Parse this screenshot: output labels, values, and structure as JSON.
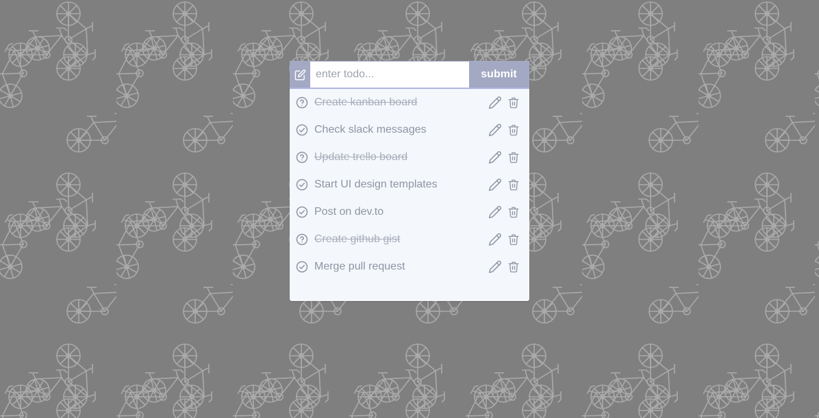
{
  "background": {
    "color": "#7f7f7f",
    "pattern_icon": "bicycle-icon",
    "pattern_color": "#a9a9a9"
  },
  "form": {
    "icon": "edit-square-icon",
    "placeholder": "enter todo...",
    "value": "",
    "submit_label": "submit"
  },
  "todos": [
    {
      "text": "Create kanban board",
      "status": "done",
      "status_icon": "question-circle-icon"
    },
    {
      "text": "Check slack messages",
      "status": "pending",
      "status_icon": "check-circle-icon"
    },
    {
      "text": "Update trello board",
      "status": "done",
      "status_icon": "question-circle-icon"
    },
    {
      "text": "Start UI design templates",
      "status": "pending",
      "status_icon": "check-circle-icon"
    },
    {
      "text": "Post on dev.to",
      "status": "pending",
      "status_icon": "check-circle-icon"
    },
    {
      "text": "Create github gist",
      "status": "done",
      "status_icon": "question-circle-icon"
    },
    {
      "text": "Merge pull request",
      "status": "pending",
      "status_icon": "check-circle-icon"
    }
  ],
  "colors": {
    "accent": "#a3a8c3",
    "card": "#f4f7fb",
    "text": "#8f94a3",
    "icon": "#8f94a3"
  }
}
